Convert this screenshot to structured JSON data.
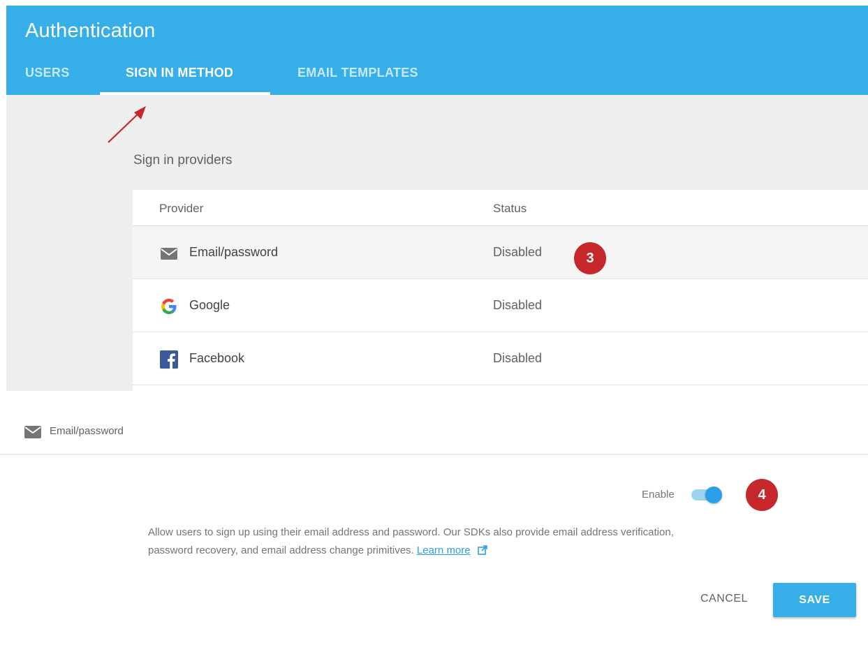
{
  "app": {
    "title": "Authentication"
  },
  "tabs": [
    {
      "label": "USERS",
      "active": false
    },
    {
      "label": "SIGN IN METHOD",
      "active": true
    },
    {
      "label": "EMAIL TEMPLATES",
      "active": false
    }
  ],
  "providers_section": {
    "title": "Sign in providers",
    "columns": {
      "provider": "Provider",
      "status": "Status"
    },
    "rows": [
      {
        "icon": "email-icon",
        "name": "Email/password",
        "status": "Disabled"
      },
      {
        "icon": "google-icon",
        "name": "Google",
        "status": "Disabled"
      },
      {
        "icon": "facebook-icon",
        "name": "Facebook",
        "status": "Disabled"
      }
    ]
  },
  "annotations": {
    "step3": "3",
    "step4": "4"
  },
  "dialog": {
    "icon": "email-icon",
    "title": "Email/password",
    "enable_label": "Enable",
    "enabled": true,
    "description": "Allow users to sign up using their email address and password. Our SDKs also provide email address verification, password recovery, and email address change primitives.",
    "learn_more": "Learn more",
    "cancel_label": "CANCEL",
    "save_label": "SAVE"
  },
  "colors": {
    "header": "#36aee8",
    "accent": "#2a9ee8",
    "badge": "#c6272b",
    "toggle_track": "#9dd3f2"
  }
}
